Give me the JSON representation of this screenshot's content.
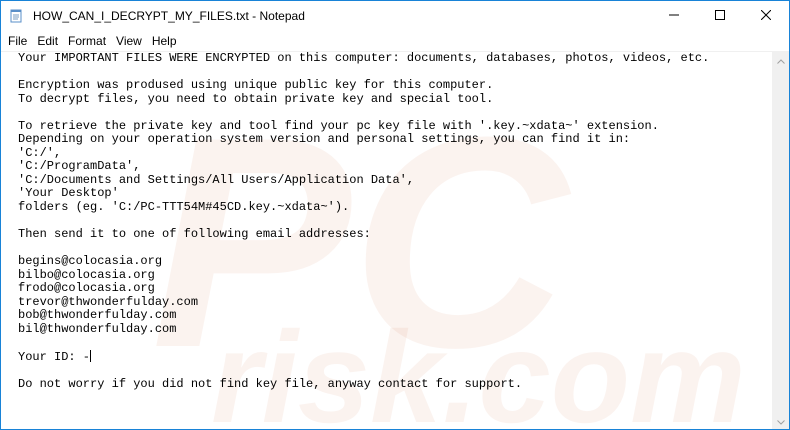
{
  "window": {
    "title": "HOW_CAN_I_DECRYPT_MY_FILES.txt - Notepad"
  },
  "menu": [
    "File",
    "Edit",
    "Format",
    "View",
    "Help"
  ],
  "document": {
    "lines": [
      "Your IMPORTANT FILES WERE ENCRYPTED on this computer: documents, databases, photos, videos, etc.",
      "",
      "Encryption was prodused using unique public key for this computer.",
      "To decrypt files, you need to obtain private key and special tool.",
      "",
      "To retrieve the private key and tool find your pc key file with '.key.~xdata~' extension.",
      "Depending on your operation system version and personal settings, you can find it in:",
      "'C:/',",
      "'C:/ProgramData',",
      "'C:/Documents and Settings/All Users/Application Data',",
      "'Your Desktop'",
      "folders (eg. 'C:/PC-TTT54M#45CD.key.~xdata~').",
      "",
      "Then send it to one of following email addresses:",
      "",
      "begins@colocasia.org",
      "bilbo@colocasia.org",
      "frodo@colocasia.org",
      "trevor@thwonderfulday.com",
      "bob@thwonderfulday.com",
      "bil@thwonderfulday.com",
      "",
      "Your ID: -",
      "",
      "Do not worry if you did not find key file, anyway contact for support."
    ]
  },
  "watermark": {
    "line1": "PC",
    "line2": "risk.com"
  },
  "icons": {
    "app": "notepad-icon",
    "minimize": "minimize-icon",
    "maximize": "maximize-icon",
    "close": "close-icon"
  },
  "colors": {
    "window_border": "#1883d7",
    "scrollbar_bg": "#f0f0f0"
  }
}
